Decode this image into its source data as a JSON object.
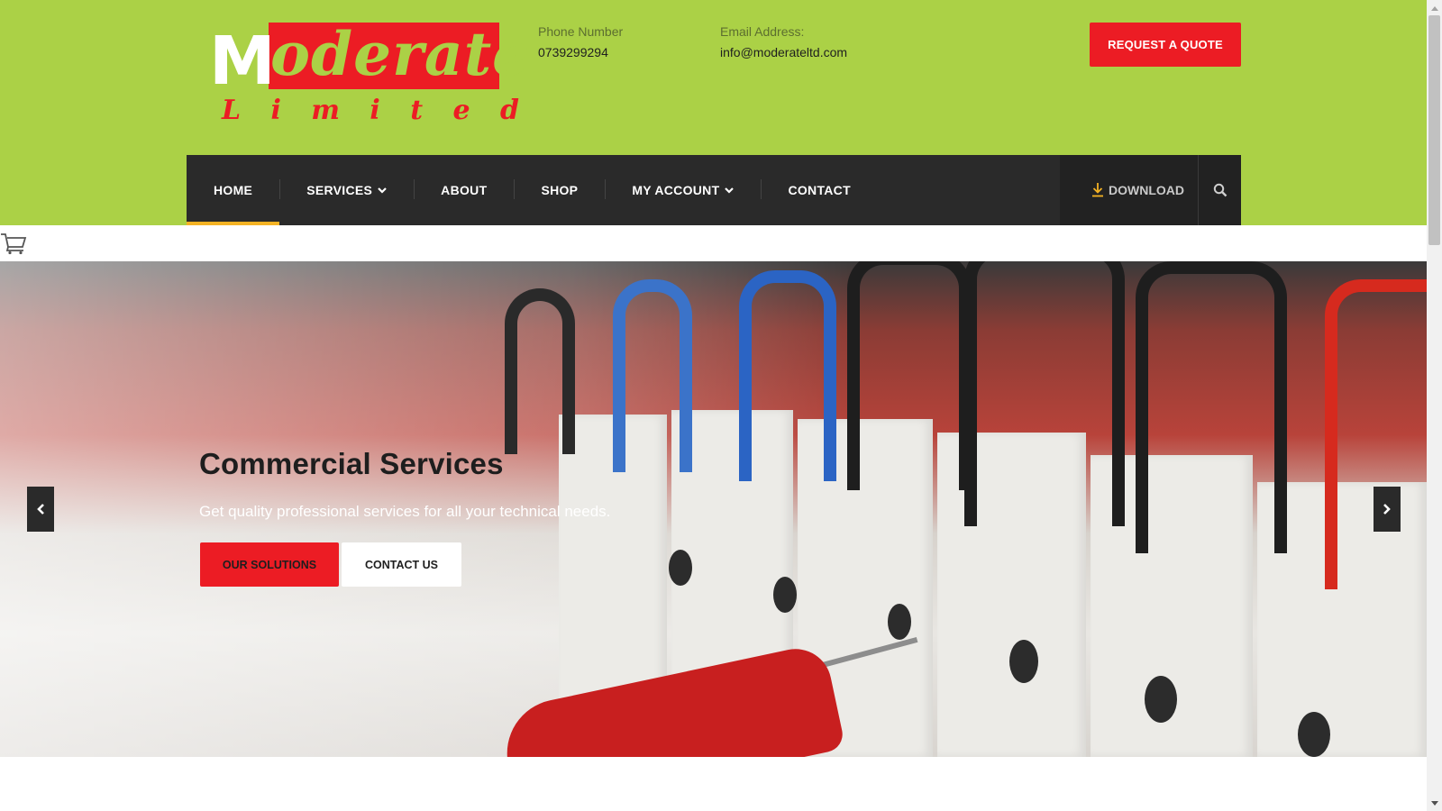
{
  "brand": {
    "logo_first_letter": "M",
    "logo_rest": "oderate",
    "logo_sub_letters": [
      "L",
      "i",
      "m",
      "i",
      "t",
      "e",
      "d"
    ]
  },
  "header": {
    "phone_label": "Phone Number",
    "phone_value": "0739299294",
    "email_label": "Email Address:",
    "email_value": "info@moderateltd.com",
    "quote_button": "REQUEST A QUOTE"
  },
  "nav": {
    "items": [
      {
        "label": "HOME",
        "active": true
      },
      {
        "label": "SERVICES",
        "dropdown": true
      },
      {
        "label": "ABOUT"
      },
      {
        "label": "SHOP"
      },
      {
        "label": "MY ACCOUNT",
        "dropdown": true
      },
      {
        "label": "CONTACT"
      }
    ],
    "download_label": "DOWNLOAD",
    "download_icon": "download-icon",
    "search_icon": "search-icon"
  },
  "cart_icon": "cart-icon",
  "hero": {
    "title": "Commercial Services",
    "subtitle": "Get quality professional services for all your technical needs.",
    "primary_button": "OUR SOLUTIONS",
    "secondary_button": "CONTACT US",
    "prev_icon": "chevron-left-icon",
    "next_icon": "chevron-right-icon"
  },
  "colors": {
    "header_bg": "#abd146",
    "accent_red": "#ec1c24",
    "nav_bg": "#2a2a2a",
    "nav_active_underline": "#f5b324"
  }
}
